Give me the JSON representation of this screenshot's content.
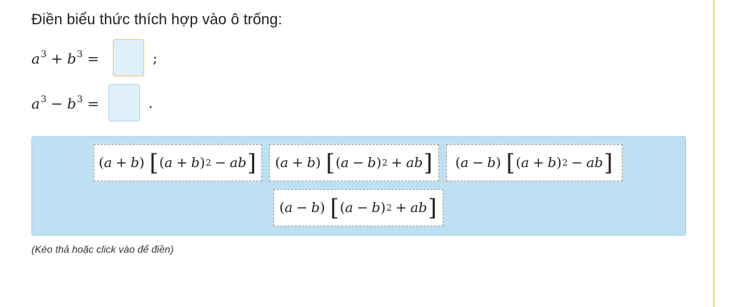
{
  "question": {
    "instruction": "Điền biểu thức thích hợp vào ô trống:"
  },
  "equations": [
    {
      "a": "a",
      "exp_a": "3",
      "op": "+",
      "b": "b",
      "exp_b": "3",
      "equals": "=",
      "separator": ";"
    },
    {
      "a": "a",
      "exp_a": "3",
      "op": "−",
      "b": "b",
      "exp_b": "3",
      "equals": "=",
      "separator": "."
    }
  ],
  "choices": [
    {
      "p1": "(",
      "v1": "a",
      "o1": "+",
      "v2": "b",
      "p2": ")",
      "lb": "[",
      "p3": "(",
      "v3": "a",
      "o2": "+",
      "v4": "b",
      "p4": ")",
      "exp": "2",
      "o3": "−",
      "term": "ab",
      "rb": "]"
    },
    {
      "p1": "(",
      "v1": "a",
      "o1": "+",
      "v2": "b",
      "p2": ")",
      "lb": "[",
      "p3": "(",
      "v3": "a",
      "o2": "−",
      "v4": "b",
      "p4": ")",
      "exp": "2",
      "o3": "+",
      "term": "ab",
      "rb": "]"
    },
    {
      "p1": "(",
      "v1": "a",
      "o1": "−",
      "v2": "b",
      "p2": ")",
      "lb": "[",
      "p3": "(",
      "v3": "a",
      "o2": "+",
      "v4": "b",
      "p4": ")",
      "exp": "2",
      "o3": "−",
      "term": "ab",
      "rb": "]"
    },
    {
      "p1": "(",
      "v1": "a",
      "o1": "−",
      "v2": "b",
      "p2": ")",
      "lb": "[",
      "p3": "(",
      "v3": "a",
      "o2": "−",
      "v4": "b",
      "p4": ")",
      "exp": "2",
      "o3": "+",
      "term": "ab",
      "rb": "]"
    }
  ],
  "hint": "(Kéo thả hoặc click vào để điền)",
  "colors": {
    "border_accent": "#f2df3a",
    "panel_bg": "#bde0f3",
    "drop_bg": "#e0f0fb"
  }
}
